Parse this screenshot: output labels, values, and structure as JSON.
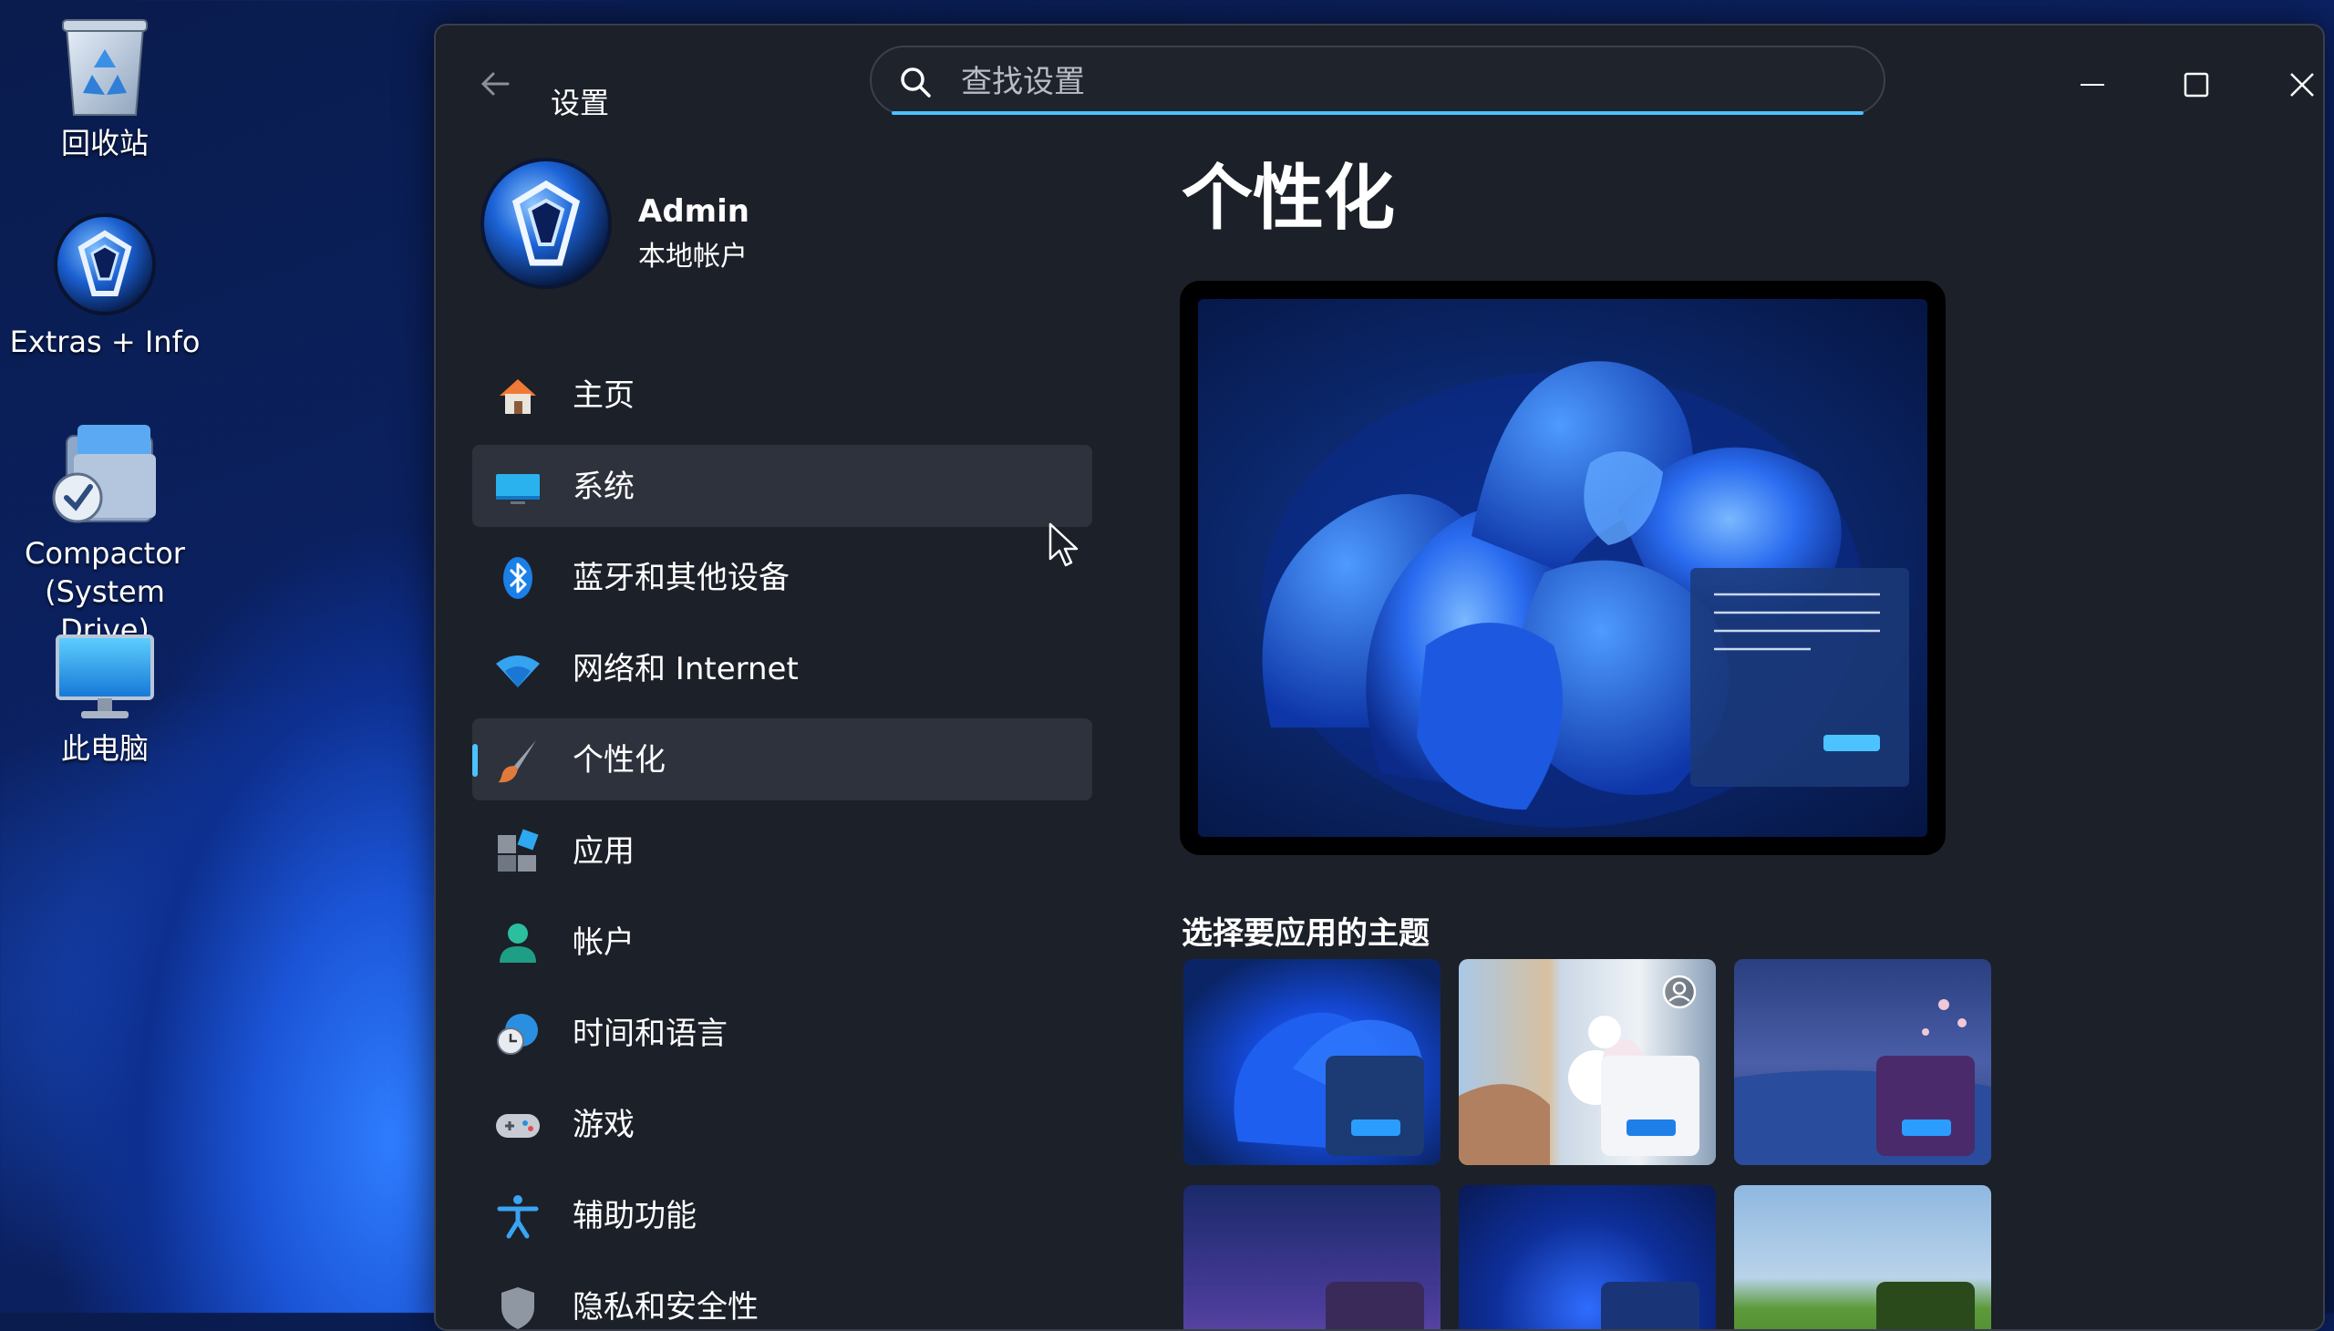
{
  "desktop": {
    "icons": [
      {
        "label": "回收站"
      },
      {
        "label": "Extras + Info"
      },
      {
        "label": "Compactor\n(System Drive)"
      },
      {
        "label": "此电脑"
      }
    ]
  },
  "window": {
    "title": "设置",
    "search_placeholder": "查找设置"
  },
  "user": {
    "name": "Admin",
    "account_type": "本地帐户"
  },
  "nav": {
    "items": [
      {
        "label": "主页",
        "icon": "home-icon"
      },
      {
        "label": "系统",
        "icon": "system-icon",
        "state": "hover"
      },
      {
        "label": "蓝牙和其他设备",
        "icon": "bluetooth-icon"
      },
      {
        "label": "网络和 Internet",
        "icon": "wifi-icon"
      },
      {
        "label": "个性化",
        "icon": "brush-icon",
        "state": "selected"
      },
      {
        "label": "应用",
        "icon": "apps-icon"
      },
      {
        "label": "帐户",
        "icon": "account-icon"
      },
      {
        "label": "时间和语言",
        "icon": "time-language-icon"
      },
      {
        "label": "游戏",
        "icon": "gamepad-icon"
      },
      {
        "label": "辅助功能",
        "icon": "accessibility-icon"
      },
      {
        "label": "隐私和安全性",
        "icon": "shield-icon"
      }
    ]
  },
  "content": {
    "page_title": "个性化",
    "themes_heading": "选择要应用的主题"
  },
  "colors": {
    "accent": "#4cc2ff",
    "window_bg": "#1c2029",
    "nav_selected_bg": "#2d323c"
  }
}
